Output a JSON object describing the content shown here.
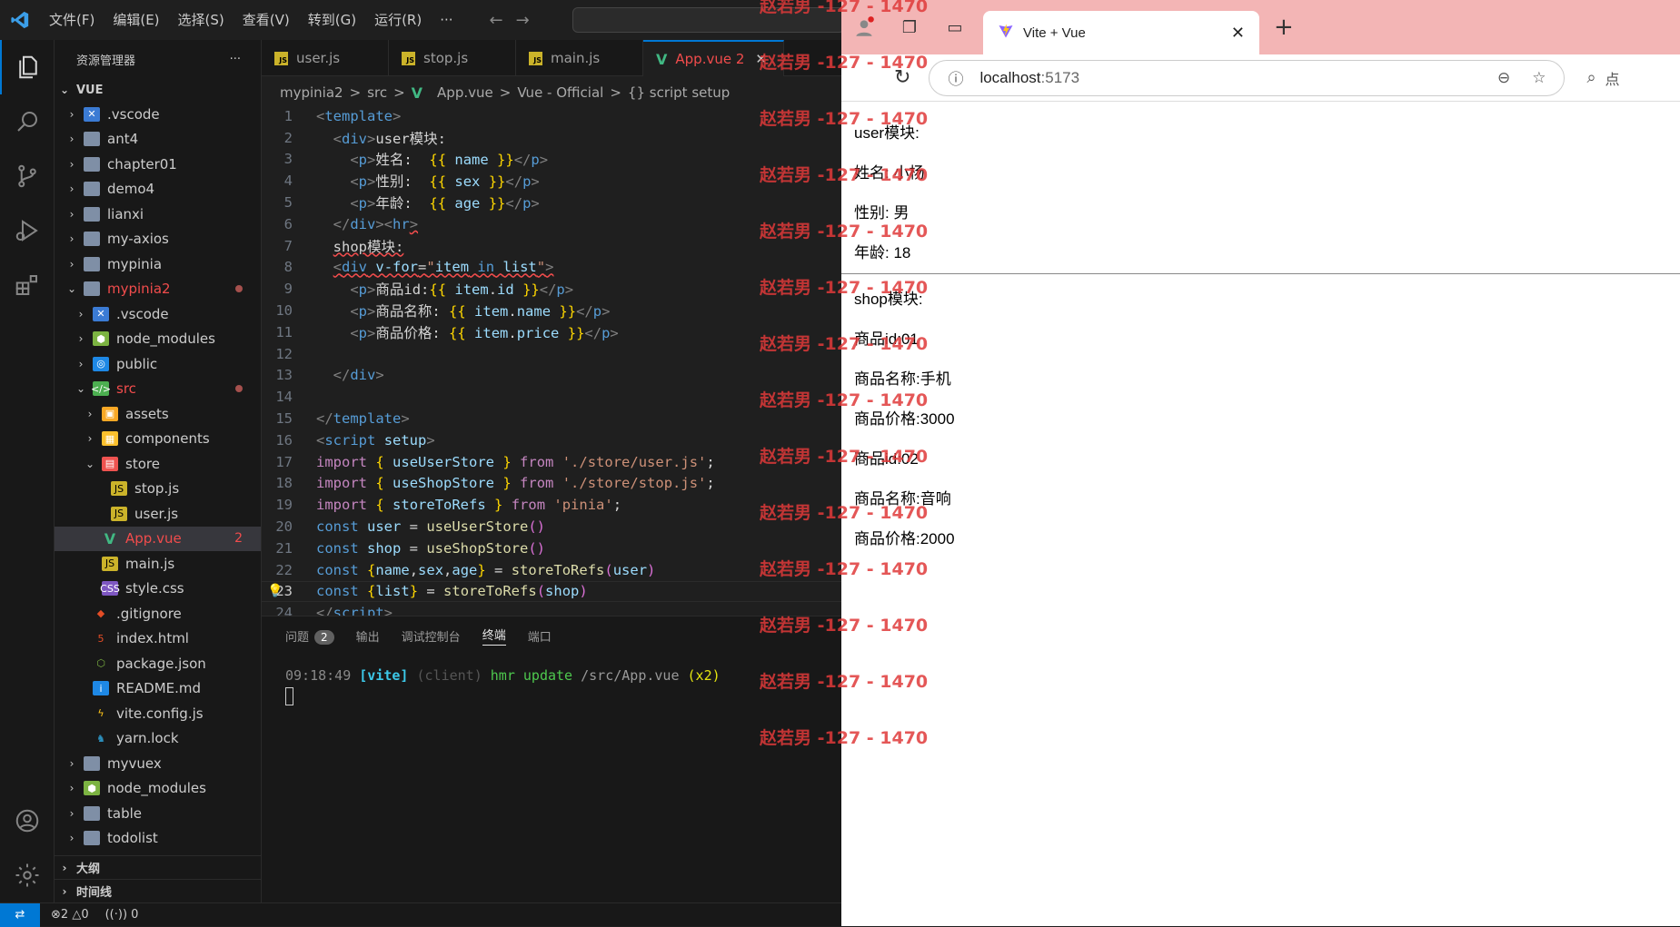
{
  "vscode": {
    "menu": [
      "文件(F)",
      "编辑(E)",
      "选择(S)",
      "查看(V)",
      "转到(G)",
      "运行(R)",
      "···"
    ],
    "explorer_title": "资源管理器",
    "explorer_more": "···",
    "root": "VUE",
    "tree": [
      {
        "label": ".vscode",
        "indent": 0,
        "chev": "›",
        "icon": "vscode"
      },
      {
        "label": "ant4",
        "indent": 0,
        "chev": "›",
        "icon": "folder"
      },
      {
        "label": "chapter01",
        "indent": 0,
        "chev": "›",
        "icon": "folder"
      },
      {
        "label": "demo4",
        "indent": 0,
        "chev": "›",
        "icon": "folder"
      },
      {
        "label": "lianxi",
        "indent": 0,
        "chev": "›",
        "icon": "folder"
      },
      {
        "label": "my-axios",
        "indent": 0,
        "chev": "›",
        "icon": "folder"
      },
      {
        "label": "mypinia",
        "indent": 0,
        "chev": "›",
        "icon": "folder"
      },
      {
        "label": "mypinia2",
        "indent": 0,
        "chev": "⌄",
        "icon": "folder-open",
        "red": true,
        "dot": true
      },
      {
        "label": ".vscode",
        "indent": 1,
        "chev": "›",
        "icon": "vscode"
      },
      {
        "label": "node_modules",
        "indent": 1,
        "chev": "›",
        "icon": "node"
      },
      {
        "label": "public",
        "indent": 1,
        "chev": "›",
        "icon": "public"
      },
      {
        "label": "src",
        "indent": 1,
        "chev": "⌄",
        "icon": "src",
        "red": true,
        "dot": true
      },
      {
        "label": "assets",
        "indent": 2,
        "chev": "›",
        "icon": "assets"
      },
      {
        "label": "components",
        "indent": 2,
        "chev": "›",
        "icon": "components"
      },
      {
        "label": "store",
        "indent": 2,
        "chev": "⌄",
        "icon": "store"
      },
      {
        "label": "stop.js",
        "indent": 3,
        "chev": "",
        "icon": "js"
      },
      {
        "label": "user.js",
        "indent": 3,
        "chev": "",
        "icon": "js"
      },
      {
        "label": "App.vue",
        "indent": 2,
        "chev": "",
        "icon": "vue",
        "red": true,
        "badge": "2",
        "sel": true
      },
      {
        "label": "main.js",
        "indent": 2,
        "chev": "",
        "icon": "js"
      },
      {
        "label": "style.css",
        "indent": 2,
        "chev": "",
        "icon": "css"
      },
      {
        "label": ".gitignore",
        "indent": 1,
        "chev": "",
        "icon": "git"
      },
      {
        "label": "index.html",
        "indent": 1,
        "chev": "",
        "icon": "html"
      },
      {
        "label": "package.json",
        "indent": 1,
        "chev": "",
        "icon": "npm"
      },
      {
        "label": "README.md",
        "indent": 1,
        "chev": "",
        "icon": "info"
      },
      {
        "label": "vite.config.js",
        "indent": 1,
        "chev": "",
        "icon": "vite"
      },
      {
        "label": "yarn.lock",
        "indent": 1,
        "chev": "",
        "icon": "yarn"
      },
      {
        "label": "myvuex",
        "indent": 0,
        "chev": "›",
        "icon": "folder"
      },
      {
        "label": "node_modules",
        "indent": 0,
        "chev": "›",
        "icon": "node"
      },
      {
        "label": "table",
        "indent": 0,
        "chev": "›",
        "icon": "folder"
      },
      {
        "label": "todolist",
        "indent": 0,
        "chev": "›",
        "icon": "folder"
      }
    ],
    "outline": "大纲",
    "timeline": "时间线",
    "tabs": [
      {
        "label": "user.js",
        "icon": "js"
      },
      {
        "label": "stop.js",
        "icon": "js"
      },
      {
        "label": "main.js",
        "icon": "js"
      },
      {
        "label": "App.vue 2",
        "icon": "vue",
        "active": true
      }
    ],
    "tab_close": "✕",
    "breadcrumb": [
      "mypinia2",
      ">",
      "src",
      ">",
      "App.vue",
      ">",
      "Vue - Official",
      ">",
      "{} script setup"
    ],
    "code_lines": [
      {
        "n": "1",
        "html": "<span class='t'>&lt;</span><span class='tg'>template</span><span class='t'>&gt;</span>"
      },
      {
        "n": "2",
        "html": "  <span class='t'>&lt;</span><span class='tg'>div</span><span class='t'>&gt;</span>user模块:"
      },
      {
        "n": "3",
        "html": "    <span class='t'>&lt;</span><span class='tg'>p</span><span class='t'>&gt;</span>姓名:  <span class='br'>{{</span> <span class='vr'>name</span> <span class='br'>}}</span><span class='t'>&lt;/</span><span class='tg'>p</span><span class='t'>&gt;</span>"
      },
      {
        "n": "4",
        "html": "    <span class='t'>&lt;</span><span class='tg'>p</span><span class='t'>&gt;</span>性别:  <span class='br'>{{</span> <span class='vr'>sex</span> <span class='br'>}}</span><span class='t'>&lt;/</span><span class='tg'>p</span><span class='t'>&gt;</span>"
      },
      {
        "n": "5",
        "html": "    <span class='t'>&lt;</span><span class='tg'>p</span><span class='t'>&gt;</span>年龄:  <span class='br'>{{</span> <span class='vr'>age</span> <span class='br'>}}</span><span class='t'>&lt;/</span><span class='tg'>p</span><span class='t'>&gt;</span>"
      },
      {
        "n": "6",
        "html": "  <span class='t'>&lt;/</span><span class='tg'>div</span><span class='t'>&gt;&lt;</span><span class='tg'>hr</span><span class='t squig'>&gt;</span>"
      },
      {
        "n": "7",
        "html": "  <span class='squig'>shop模块:</span>"
      },
      {
        "n": "8",
        "html": "  <span class='squig'><span class='t'>&lt;</span><span class='tg'>div</span> <span class='at'>v-for</span>=<span class='str'>\"</span><span class='vr'>item</span> <span class='kw2'>in</span> <span class='vr'>list</span><span class='str'>\"</span><span class='t'>&gt;</span></span>"
      },
      {
        "n": "9",
        "html": "    <span class='t'>&lt;</span><span class='tg'>p</span><span class='t'>&gt;</span>商品id:<span class='br'>{{</span> <span class='vr'>item</span>.<span class='vr'>id</span> <span class='br'>}}</span><span class='t'>&lt;/</span><span class='tg'>p</span><span class='t'>&gt;</span>"
      },
      {
        "n": "10",
        "html": "    <span class='t'>&lt;</span><span class='tg'>p</span><span class='t'>&gt;</span>商品名称: <span class='br'>{{</span> <span class='vr'>item</span>.<span class='vr'>name</span> <span class='br'>}}</span><span class='t'>&lt;/</span><span class='tg'>p</span><span class='t'>&gt;</span>"
      },
      {
        "n": "11",
        "html": "    <span class='t'>&lt;</span><span class='tg'>p</span><span class='t'>&gt;</span>商品价格: <span class='br'>{{</span> <span class='vr'>item</span>.<span class='vr'>price</span> <span class='br'>}}</span><span class='t'>&lt;/</span><span class='tg'>p</span><span class='t'>&gt;</span>"
      },
      {
        "n": "12",
        "html": ""
      },
      {
        "n": "13",
        "html": "  <span class='t'>&lt;/</span><span class='tg'>div</span><span class='t'>&gt;</span>"
      },
      {
        "n": "14",
        "html": ""
      },
      {
        "n": "15",
        "html": "<span class='t'>&lt;/</span><span class='tg'>template</span><span class='t'>&gt;</span>"
      },
      {
        "n": "16",
        "html": "<span class='t'>&lt;</span><span class='tg'>script</span> <span class='at'>setup</span><span class='t'>&gt;</span>"
      },
      {
        "n": "17",
        "html": "<span class='kw'>import</span> <span class='br'>{</span> <span class='vr'>useUserStore</span> <span class='br'>}</span> <span class='kw'>from</span> <span class='str'>'./store/user.js'</span>;"
      },
      {
        "n": "18",
        "html": "<span class='kw'>import</span> <span class='br'>{</span> <span class='vr'>useShopStore</span> <span class='br'>}</span> <span class='kw'>from</span> <span class='str'>'./store/stop.js'</span>;"
      },
      {
        "n": "19",
        "html": "<span class='kw'>import</span> <span class='br'>{</span> <span class='vr'>storeToRefs</span> <span class='br'>}</span> <span class='kw'>from</span> <span class='str'>'pinia'</span>;"
      },
      {
        "n": "20",
        "html": "<span class='kw2'>const</span> <span class='vr'>user</span> = <span class='fn'>useUserStore</span><span class='br2'>()</span>"
      },
      {
        "n": "21",
        "html": "<span class='kw2'>const</span> <span class='vr'>shop</span> = <span class='fn'>useShopStore</span><span class='br2'>()</span>"
      },
      {
        "n": "22",
        "html": "<span class='kw2'>const</span> <span class='br'>{</span><span class='vr'>name</span>,<span class='vr'>sex</span>,<span class='vr'>age</span><span class='br'>}</span> = <span class='fn'>storeToRefs</span><span class='br2'>(</span><span class='vr'>user</span><span class='br2'>)</span>"
      },
      {
        "n": "23",
        "html": "<span class='kw2'>const</span> <span class='br'>{</span><span class='vr'>list</span><span class='br'>}</span> = <span class='fn'>storeToRefs</span><span class='br2'>(</span><span class='vr'>shop</span><span class='br2'>)</span>",
        "cur": true
      },
      {
        "n": "24",
        "html": "<span class='t'>&lt;/</span><span class='tg'>script</span><span class='t'>&gt;</span>"
      }
    ],
    "panel_tabs": [
      "问题",
      "输出",
      "调试控制台",
      "终端",
      "端口"
    ],
    "problems_count": "2",
    "terminal": {
      "time": "09:18:49",
      "vite": "[vite]",
      "client": "(client)",
      "msg": "hmr update",
      "path": "/src/App.vue",
      "count": "(x2)"
    },
    "status": {
      "errors": "2",
      "warnings": "0",
      "ports": "0"
    }
  },
  "browser": {
    "tab_title": "Vite + Vue",
    "tab_close": "✕",
    "new_tab": "+",
    "url_host": "localhost",
    "url_port": ":5173",
    "search_partial": "点",
    "user_heading": "user模块:",
    "user_fields": [
      "姓名:  小杨",
      "性别:  男",
      "年龄:  18"
    ],
    "shop_heading": "shop模块:",
    "shop_items": [
      "商品id:01",
      "商品名称:手机",
      "商品价格:3000",
      "商品id:02",
      "商品名称:音响",
      "商品价格:2000"
    ]
  },
  "watermark": "赵若男 -127 - 1470",
  "colors": {
    "accent": "#0078d4",
    "error": "#f14c4c",
    "browser_tabbar": "#f3b5b5"
  }
}
